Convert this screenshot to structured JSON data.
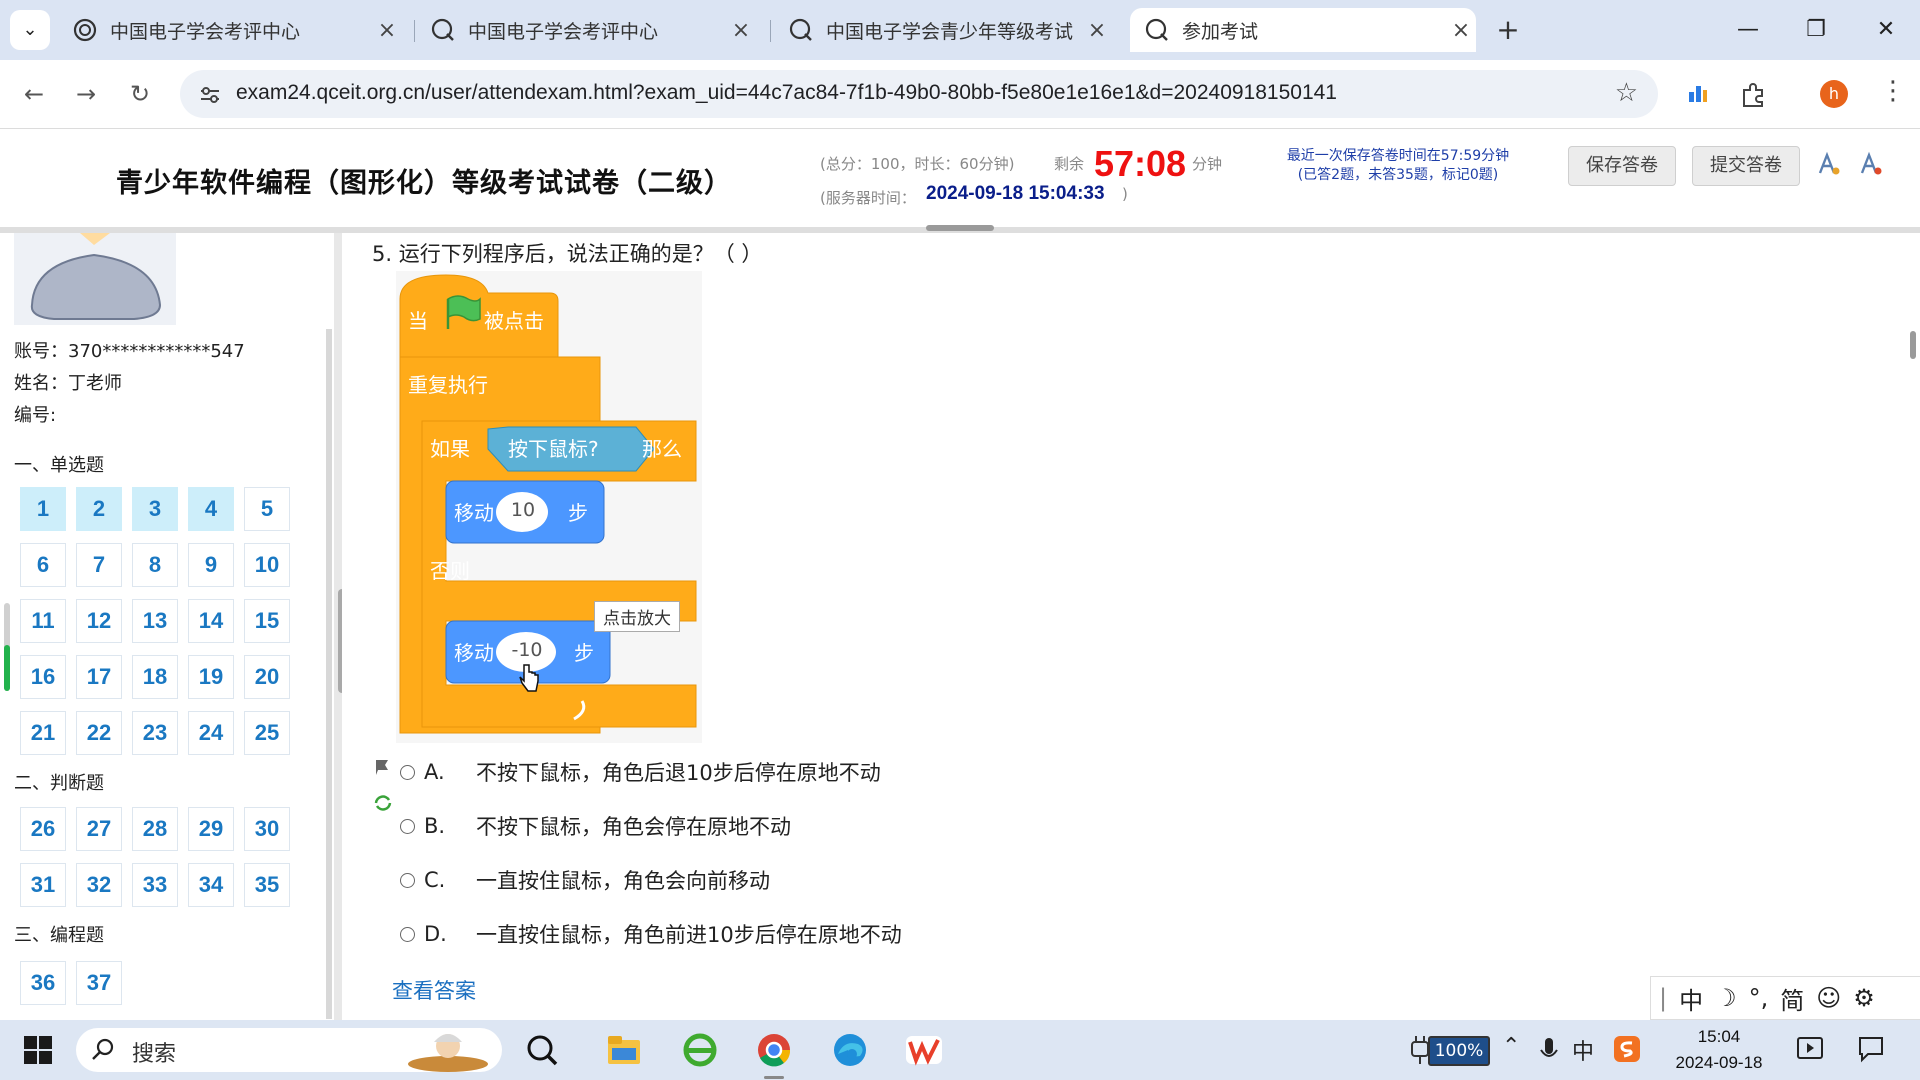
{
  "browser": {
    "tabs": [
      {
        "title": "中国电子学会考评中心",
        "active": false
      },
      {
        "title": "中国电子学会考评中心",
        "active": false
      },
      {
        "title": "中国电子学会青少年等级考试",
        "active": false
      },
      {
        "title": "参加考试",
        "active": true
      }
    ],
    "new_tab": "+",
    "url": "exam24.qceit.org.cn/user/attendexam.html?exam_uid=44c7ac84-7f1b-49b0-80bb-f5e80e1e16e1&d=20240918150141",
    "profile_initial": "h"
  },
  "exam_header": {
    "title": "青少年软件编程（图形化）等级考试试卷（二级）",
    "meta": "(总分：100，时长：60分钟)",
    "remain_label": "剩余",
    "remain_value": "57:08",
    "remain_unit": "分钟",
    "server_time_label": "(服务器时间：",
    "server_time_value": "2024-09-18 15:04:33",
    "server_time_close": ")",
    "save_info_line1": "最近一次保存答卷时间在57:59分钟",
    "save_info_line2": "(已答2题，未答35题，标记0题)",
    "save_button": "保存答卷",
    "submit_button": "提交答卷"
  },
  "sidebar": {
    "account": "账号：370************547",
    "name": "姓名：丁老师",
    "number": "编号:",
    "sections": [
      {
        "title": "一、单选题",
        "questions": [
          "1",
          "2",
          "3",
          "4",
          "5",
          "6",
          "7",
          "8",
          "9",
          "10",
          "11",
          "12",
          "13",
          "14",
          "15",
          "16",
          "17",
          "18",
          "19",
          "20",
          "21",
          "22",
          "23",
          "24",
          "25"
        ]
      },
      {
        "title": "二、判断题",
        "questions": [
          "26",
          "27",
          "28",
          "29",
          "30",
          "31",
          "32",
          "33",
          "34",
          "35"
        ]
      },
      {
        "title": "三、编程题",
        "questions": [
          "36",
          "37"
        ]
      }
    ]
  },
  "question": {
    "text": "5. 运行下列程序后，说法正确的是？（ ）",
    "blocks": {
      "hat_when": "当",
      "hat_clicked": "被点击",
      "forever": "重复执行",
      "if": "如果",
      "condition": "按下鼠标?",
      "then": "那么",
      "move1_label": "移动",
      "move1_value": "10",
      "move1_unit": "步",
      "else": "否则",
      "move2_label": "移动",
      "move2_value": "-10",
      "move2_unit": "步"
    },
    "zoom_tooltip": "点击放大",
    "options": [
      {
        "letter": "A.",
        "text": "不按下鼠标，角色后退10步后停在原地不动"
      },
      {
        "letter": "B.",
        "text": "不按下鼠标，角色会停在原地不动"
      },
      {
        "letter": "C.",
        "text": "一直按住鼠标，角色会向前移动"
      },
      {
        "letter": "D.",
        "text": "一直按住鼠标，角色前进10步后停在原地不动"
      }
    ],
    "view_answer": "查看答案"
  },
  "ime": {
    "mode": "中",
    "punct": "°,",
    "simplified": "简"
  },
  "taskbar": {
    "search": "搜索",
    "battery": "100%",
    "ime_indicator": "中",
    "time": "15:04",
    "date": "2024-09-18"
  }
}
